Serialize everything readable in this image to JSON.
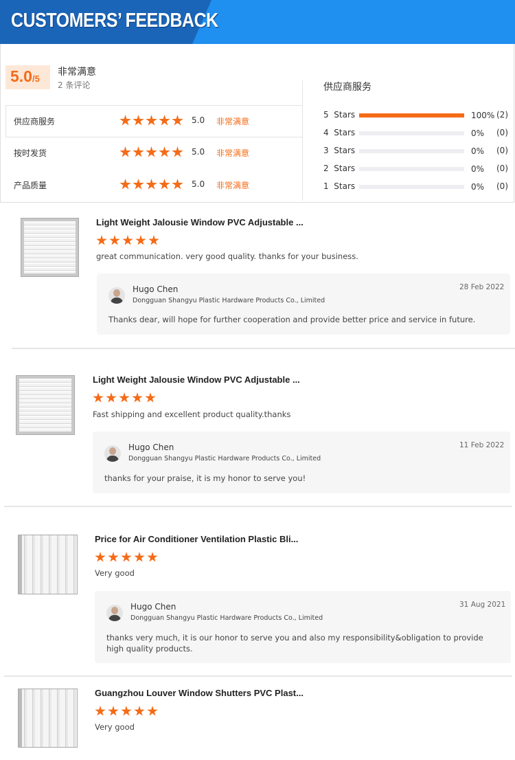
{
  "header": {
    "title": "CUSTOMERS’ FEEDBACK"
  },
  "summary": {
    "score": "5.0",
    "score_max": "/5",
    "rating_text": "非常满意",
    "review_count": "2 条评论",
    "categories": [
      {
        "label": "供应商服务",
        "value": "5.0",
        "stars": 5,
        "rating_text": "非常满意"
      },
      {
        "label": "按时发货",
        "value": "5.0",
        "stars": 5,
        "rating_text": "非常满意"
      },
      {
        "label": "产品质量",
        "value": "5.0",
        "stars": 5,
        "rating_text": "非常满意"
      }
    ],
    "breakdown_title": "供应商服务",
    "breakdown": [
      {
        "label": "5  Stars",
        "fraction": 1.0,
        "percent": "100%",
        "count": "(2)"
      },
      {
        "label": "4  Stars",
        "fraction": 0.0,
        "percent": "0%",
        "count": "(0)"
      },
      {
        "label": "3  Stars",
        "fraction": 0.0,
        "percent": "0%",
        "count": "(0)"
      },
      {
        "label": "2  Stars",
        "fraction": 0.0,
        "percent": "0%",
        "count": "(0)"
      },
      {
        "label": "1  Stars",
        "fraction": 0.0,
        "percent": "0%",
        "count": "(0)"
      }
    ]
  },
  "reviews": [
    {
      "product_title": "Light Weight Jalousie Window PVC Adjustable ...",
      "stars": 5,
      "comment": "great communication. very good quality. thanks for your business.",
      "reply": {
        "name": "Hugo Chen",
        "company": "Dongguan Shangyu Plastic Hardware Products Co., Limited",
        "date": "28 Feb 2022",
        "text": "Thanks dear, will hope for further cooperation and provide better price and service in future."
      }
    },
    {
      "product_title": "Light Weight Jalousie Window PVC Adjustable ...",
      "stars": 5,
      "comment": "Fast shipping and excellent product quality.thanks",
      "reply": {
        "name": "Hugo Chen",
        "company": "Dongguan Shangyu Plastic Hardware Products Co., Limited",
        "date": "11 Feb 2022",
        "text": "thanks for your praise, it is my honor to serve you!"
      }
    },
    {
      "product_title": "Price for Air Conditioner Ventilation Plastic Bli...",
      "stars": 5,
      "comment": "Very good",
      "reply": {
        "name": "Hugo Chen",
        "company": "Dongguan Shangyu Plastic Hardware Products Co., Limited",
        "date": "31 Aug 2021",
        "text": "thanks very much, it is our honor to serve you and also my responsibility&obligation to provide high quality products."
      }
    },
    {
      "product_title": "Guangzhou Louver Window Shutters PVC Plast...",
      "stars": 5,
      "comment": "Very good"
    }
  ],
  "colors": {
    "accent": "#f56b16",
    "banner_light": "#1f8ff0",
    "banner_dark": "#1a65b8"
  },
  "icons": {
    "star": "star-icon",
    "avatar": "avatar-icon"
  }
}
